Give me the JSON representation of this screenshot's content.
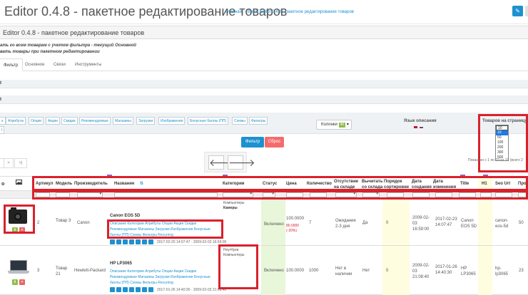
{
  "header": {
    "title": "Editor 0.4.8 - пакетное редактирование товаров",
    "crumb_home": "Главная",
    "crumb_current": "Batch Editor 0.4.8 - пакетное редактирование товаров"
  },
  "panel": {
    "title": "Editor 0.4.8 - пакетное редактирование товаров",
    "note1": "ать ко всем товарам с учетом фильтра - текущий Основной",
    "note2": "вать товары при пакетном редактировании"
  },
  "tabs": [
    "Фильтр",
    "Основное",
    "Связи",
    "Инструменты"
  ],
  "chips": [
    "Атрибуты",
    "Опции",
    "Акции",
    "Скидки",
    "Рекомендуемые",
    "Магазины",
    "Загрузки",
    "Изображения",
    "Бонусные баллы (ПП)",
    "Схемы",
    "Фильтры"
  ],
  "columns_select": {
    "label": "Колонки",
    "count": "40"
  },
  "language": {
    "label": "Язык описания"
  },
  "per_page": {
    "label": "Товаров на страницу",
    "current": "10",
    "options": [
      "10",
      "50",
      "100",
      "200",
      "300",
      "500"
    ]
  },
  "buttons": {
    "filter": "Фильтр",
    "reset": "Сброс"
  },
  "pager": {
    "next": ">",
    "last": ">|",
    "shown": "Показано с 1 по 10 из 19 (всего 2"
  },
  "table": {
    "headers": [
      "Артикул",
      "Модель",
      "Производитель",
      "Название",
      "Категории",
      "Статус",
      "Цена",
      "Количество",
      "Отсутствие на складе",
      "Вычитать со склада",
      "Порядок сортировки",
      "Дата создания",
      "Дата изменения",
      "Title",
      "H1",
      "Seo Url",
      "Прос"
    ]
  },
  "rows": [
    {
      "sku": "2",
      "model": "Товар 3",
      "manufacturer": "Canon",
      "name": "Canon EOS 5D",
      "links": "Описание  Категории  Атрибуты  Опции  Акции  Скидки  Рекомендуемые  Магазины  Загрузки  Изображения  Бонусные баллы (ПП)  Схемы  Фильтры  Recurring",
      "dates": "2017-02-20 14:07:47 · 2009-02-03 16:59:00",
      "categories": [
        "Компьютеры",
        "Камеры"
      ],
      "status": "Включено",
      "price": "100.0000",
      "price_special": "80.0000",
      "price_pct": "(-20%)",
      "qty": "7",
      "stock_status": "Ожидание 2-3 дня",
      "subtract": "Да",
      "sort": "0",
      "date_added": "2009-02-03 16:59:00",
      "date_modified": "2017-02-23 14:07:47",
      "title": "Canon EOS 5D",
      "seo": "canon-eos-5d",
      "views": "50"
    },
    {
      "sku": "3",
      "model": "Товар 21",
      "manufacturer": "Hewlett-Packard",
      "name": "HP LP3065",
      "links": "Описание  Категории  Атрибуты  Опции  Акции  Скидки  Рекомендуемые  Магазины  Загрузки  Изображения  Бонусные баллы (ПП)  Схемы  Фильтры  Recurring",
      "dates": "2017-01-26 14:40:30 · 2009-02-03 21:08:40",
      "categories": [
        "Ноутбуки",
        "Компьютеры"
      ],
      "status": "Включено",
      "price": "100.0000",
      "qty": "1000",
      "stock_status": "Нет в наличии",
      "subtract": "Нет",
      "sort": "0",
      "date_added": "2009-02-03 21:08:40",
      "date_modified": "2017-01-26 14:40:30",
      "title": "HP LP3065",
      "seo": "hp-lp3065",
      "views": "23"
    }
  ]
}
